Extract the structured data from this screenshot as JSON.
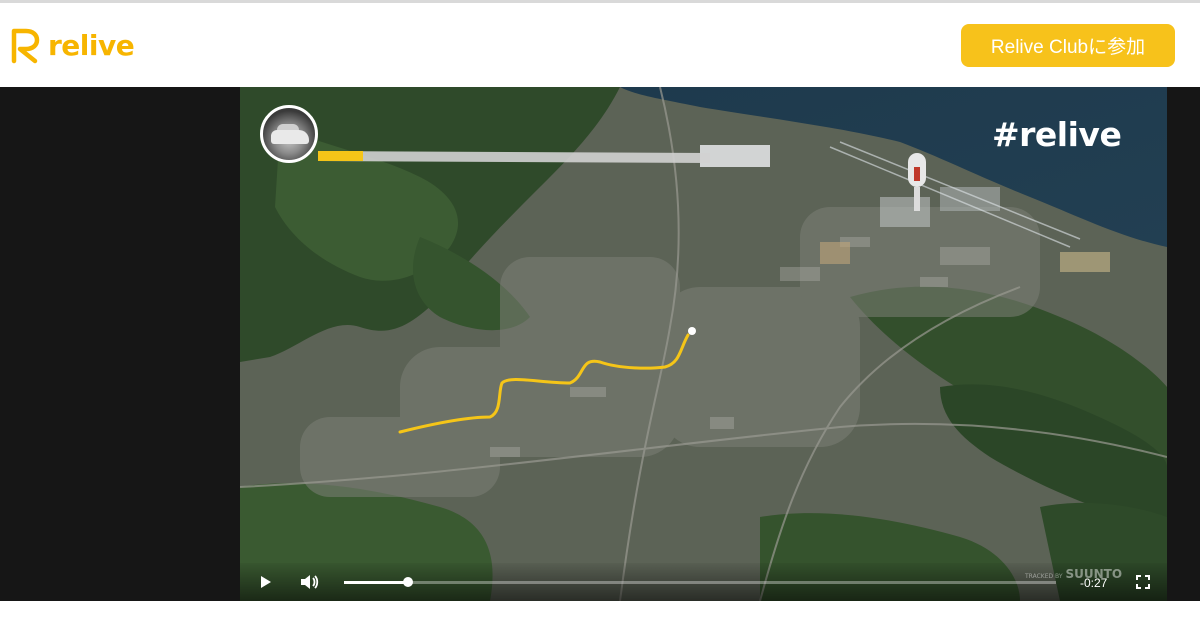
{
  "header": {
    "logo_text": "relive",
    "join_button_label": "Relive Clubに参加"
  },
  "video": {
    "hashtag": "#relive",
    "overlay_brand": "SUUNTO",
    "overlay_tracked_by": "TRACKED BY",
    "time_remaining": "-0:27",
    "progress_fraction": 0.09,
    "icons": [
      "play-icon",
      "volume-icon",
      "fullscreen-icon"
    ],
    "colors": {
      "route": "#f5c518",
      "accent": "#f7c21b"
    }
  }
}
